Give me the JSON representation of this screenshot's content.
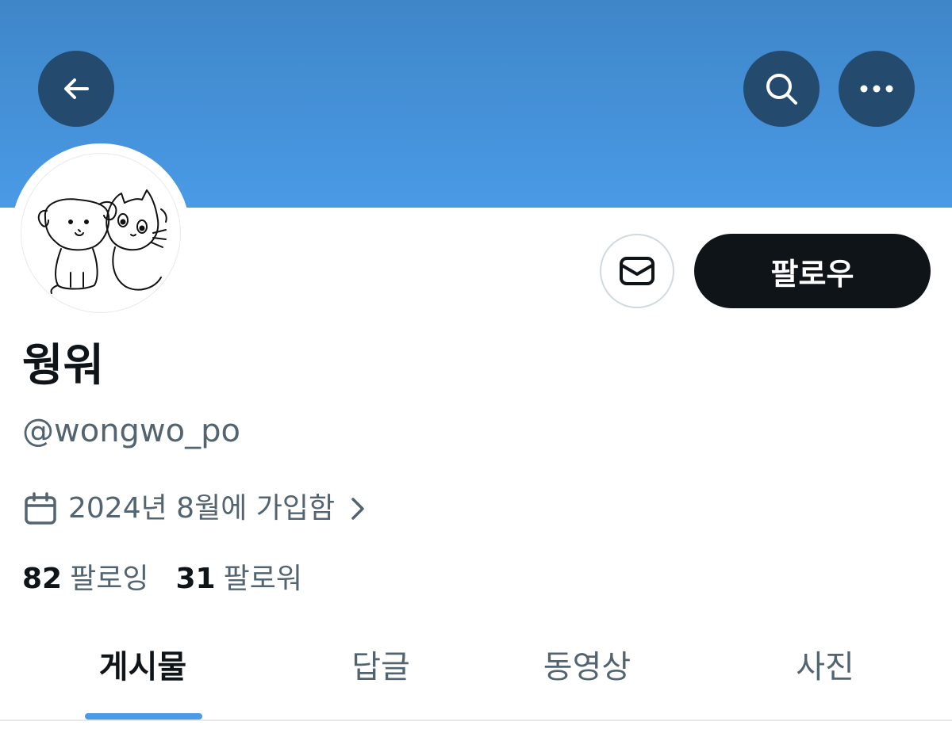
{
  "header": {
    "back_icon": "arrow-left-icon",
    "search_icon": "search-icon",
    "more_icon": "more-horizontal-icon",
    "banner_color": "#4a9ae6"
  },
  "profile": {
    "display_name": "웡워",
    "handle": "@wongwo_po",
    "joined": "2024년 8월에 가입함",
    "following_count": "82",
    "following_label": "팔로잉",
    "followers_count": "31",
    "followers_label": "팔로워"
  },
  "actions": {
    "message_icon": "envelope-icon",
    "follow_label": "팔로우"
  },
  "tabs": [
    {
      "label": "게시물",
      "active": true
    },
    {
      "label": "답글",
      "active": false
    },
    {
      "label": "동영상",
      "active": false
    },
    {
      "label": "사진",
      "active": false
    }
  ],
  "colors": {
    "accent": "#4a9ae6",
    "text_primary": "#0f1419",
    "text_secondary": "#536471"
  }
}
